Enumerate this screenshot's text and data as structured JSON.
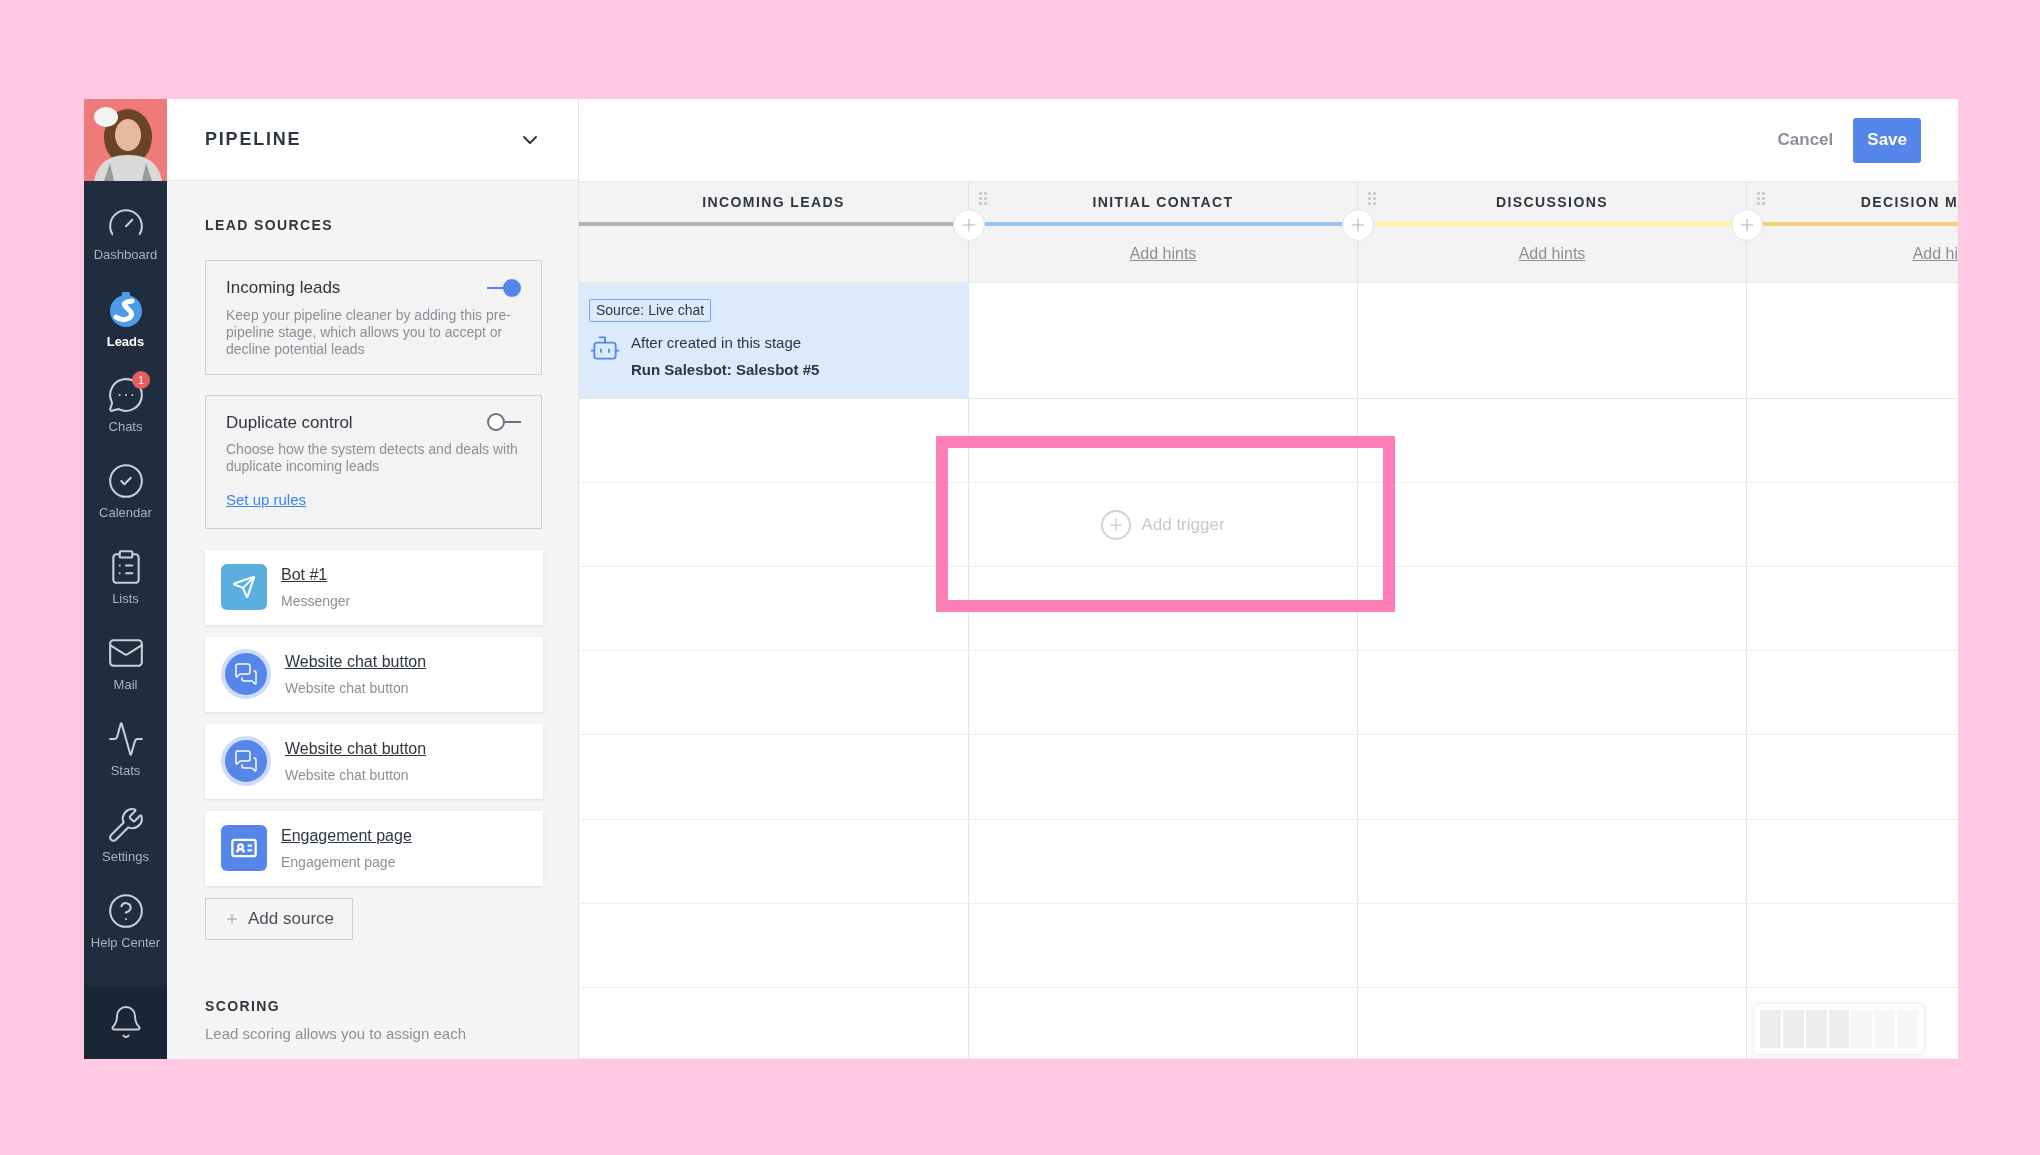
{
  "nav": {
    "items": [
      {
        "label": "Dashboard",
        "kind": "dashboard",
        "selected": false
      },
      {
        "label": "Leads",
        "kind": "leads",
        "selected": true
      },
      {
        "label": "Chats",
        "kind": "chats",
        "selected": false,
        "badge": "1"
      },
      {
        "label": "Calendar",
        "kind": "calendar",
        "selected": false
      },
      {
        "label": "Lists",
        "kind": "lists",
        "selected": false
      },
      {
        "label": "Mail",
        "kind": "mail",
        "selected": false
      },
      {
        "label": "Stats",
        "kind": "stats",
        "selected": false
      },
      {
        "label": "Settings",
        "kind": "settings",
        "selected": false
      },
      {
        "label": "Help Center",
        "kind": "help",
        "selected": false
      }
    ]
  },
  "panel": {
    "title": "PIPELINE",
    "section_title": "LEAD SOURCES",
    "toggles": [
      {
        "title": "Incoming leads",
        "description": "Keep your pipeline cleaner by adding this pre-pipeline stage, which allows you to accept or decline potential leads",
        "on": true
      },
      {
        "title": "Duplicate control",
        "description": "Choose how the system detects and deals with duplicate incoming leads",
        "on": false,
        "link": "Set up rules"
      }
    ],
    "sources": [
      {
        "name": "Bot #1",
        "type": "Messenger",
        "kind": "messenger"
      },
      {
        "name": "Website chat button",
        "type": "Website chat button",
        "kind": "chat"
      },
      {
        "name": "Website chat button",
        "type": "Website chat button",
        "kind": "chat"
      },
      {
        "name": "Engagement page",
        "type": "Engagement page",
        "kind": "page"
      }
    ],
    "add_source": "Add source",
    "scoring": {
      "title": "SCORING",
      "text": "Lead scoring allows you to assign each"
    }
  },
  "actions": {
    "cancel": "Cancel",
    "save": "Save"
  },
  "board": {
    "stages": [
      {
        "name": "INCOMING LEADS",
        "color": "#b3b3b3"
      },
      {
        "name": "INITIAL CONTACT",
        "color": "#99c2f7",
        "hint": "Add hints"
      },
      {
        "name": "DISCUSSIONS",
        "color": "#fff59d",
        "hint": "Add hints"
      },
      {
        "name": "DECISION M",
        "color": "#f7cd76",
        "hint": "Add hi"
      }
    ],
    "trigger": {
      "source": "Source: Live chat",
      "condition": "After created in this stage",
      "action": "Run Salesbot: Salesbot #5"
    },
    "add_trigger": {
      "label": "Add trigger",
      "highlighted": true
    }
  }
}
